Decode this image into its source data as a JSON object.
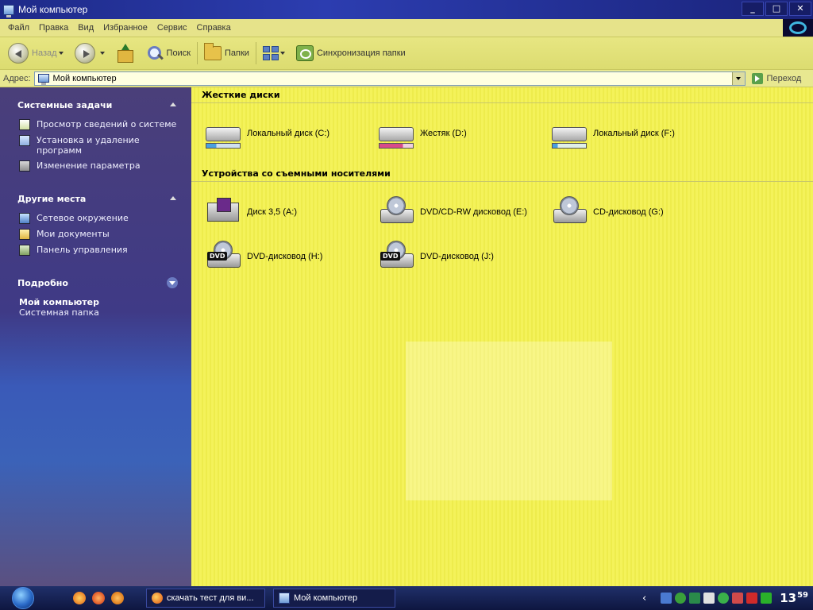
{
  "window": {
    "title": "Мой компьютер",
    "controls": {
      "minimize": "_",
      "maximize": "□",
      "close": "✕"
    }
  },
  "menu": [
    "Файл",
    "Правка",
    "Вид",
    "Избранное",
    "Сервис",
    "Справка"
  ],
  "toolbar": {
    "back_label": "Назад",
    "search_label": "Поиск",
    "folders_label": "Папки",
    "sync_label": "Синхронизация папки"
  },
  "address": {
    "label": "Адрес:",
    "value": "Мой компьютер",
    "go_label": "Переход"
  },
  "sidebar": {
    "system_tasks": {
      "title": "Системные задачи",
      "items": [
        "Просмотр сведений о системе",
        "Установка и удаление программ",
        "Изменение параметра"
      ]
    },
    "other_places": {
      "title": "Другие места",
      "items": [
        "Сетевое окружение",
        "Мои документы",
        "Панель управления"
      ]
    },
    "details": {
      "title": "Подробно",
      "name": "Мой компьютер",
      "type": "Системная папка"
    }
  },
  "content": {
    "hard_drives": {
      "title": "Жесткие диски",
      "items": [
        "Локальный диск (C:)",
        "Жестяк (D:)",
        "Локальный диск (F:)"
      ]
    },
    "removable": {
      "title": "Устройства со съемными носителями",
      "items": [
        "Диск 3,5 (A:)",
        "DVD/CD-RW дисковод (E:)",
        "CD-дисковод (G:)",
        "DVD-дисковод (H:)",
        "DVD-дисковод (J:)"
      ],
      "dvd_badge": "DVD"
    }
  },
  "taskbar": {
    "tasks": [
      "скачать тест для ви...",
      "Мой компьютер"
    ],
    "tray_chevron": "‹",
    "clock_hour": "13",
    "clock_min": "59"
  },
  "colors": {
    "menu_bg": "#e6e38a",
    "content_bg": "#f4f25a",
    "pane_bg": "#3f3a86",
    "titlebar": "#2c3db0"
  }
}
